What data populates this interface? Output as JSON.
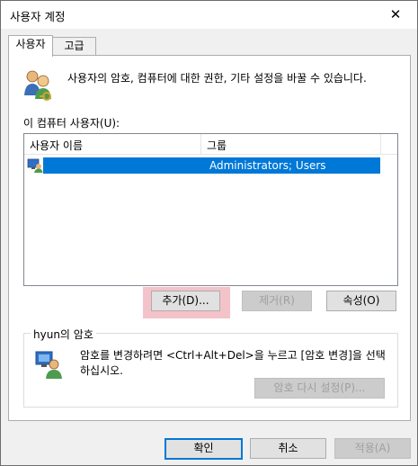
{
  "window": {
    "title": "사용자 계정",
    "close_glyph": "✕"
  },
  "tabs": [
    {
      "label": "사용자",
      "active": true
    },
    {
      "label": "고급",
      "active": false
    }
  ],
  "intro_text": "사용자의 암호, 컴퓨터에 대한 권한, 기타 설정을 바꿀 수 있습니다.",
  "user_list": {
    "label": "이 컴퓨터 사용자(U):",
    "columns": [
      "사용자 이름",
      "그룹"
    ],
    "rows": [
      {
        "name": "",
        "groups": "Administrators; Users",
        "selected": true
      }
    ]
  },
  "list_buttons": {
    "add": "추가(D)...",
    "remove": "제거(R)",
    "properties": "속성(O)"
  },
  "password_group": {
    "title": "hyun의 암호",
    "text": "암호를 변경하려면 <Ctrl+Alt+Del>을 누르고 [암호 변경]을 선택하십시오.",
    "reset_button": "암호 다시 설정(P)..."
  },
  "dialog_buttons": {
    "ok": "확인",
    "cancel": "취소",
    "apply": "적용(A)"
  },
  "colors": {
    "selection": "#0078d7",
    "highlight": "#f4c3c9"
  },
  "icons": [
    "users-icon",
    "user-computer-icon",
    "user-key-icon",
    "close-icon"
  ]
}
